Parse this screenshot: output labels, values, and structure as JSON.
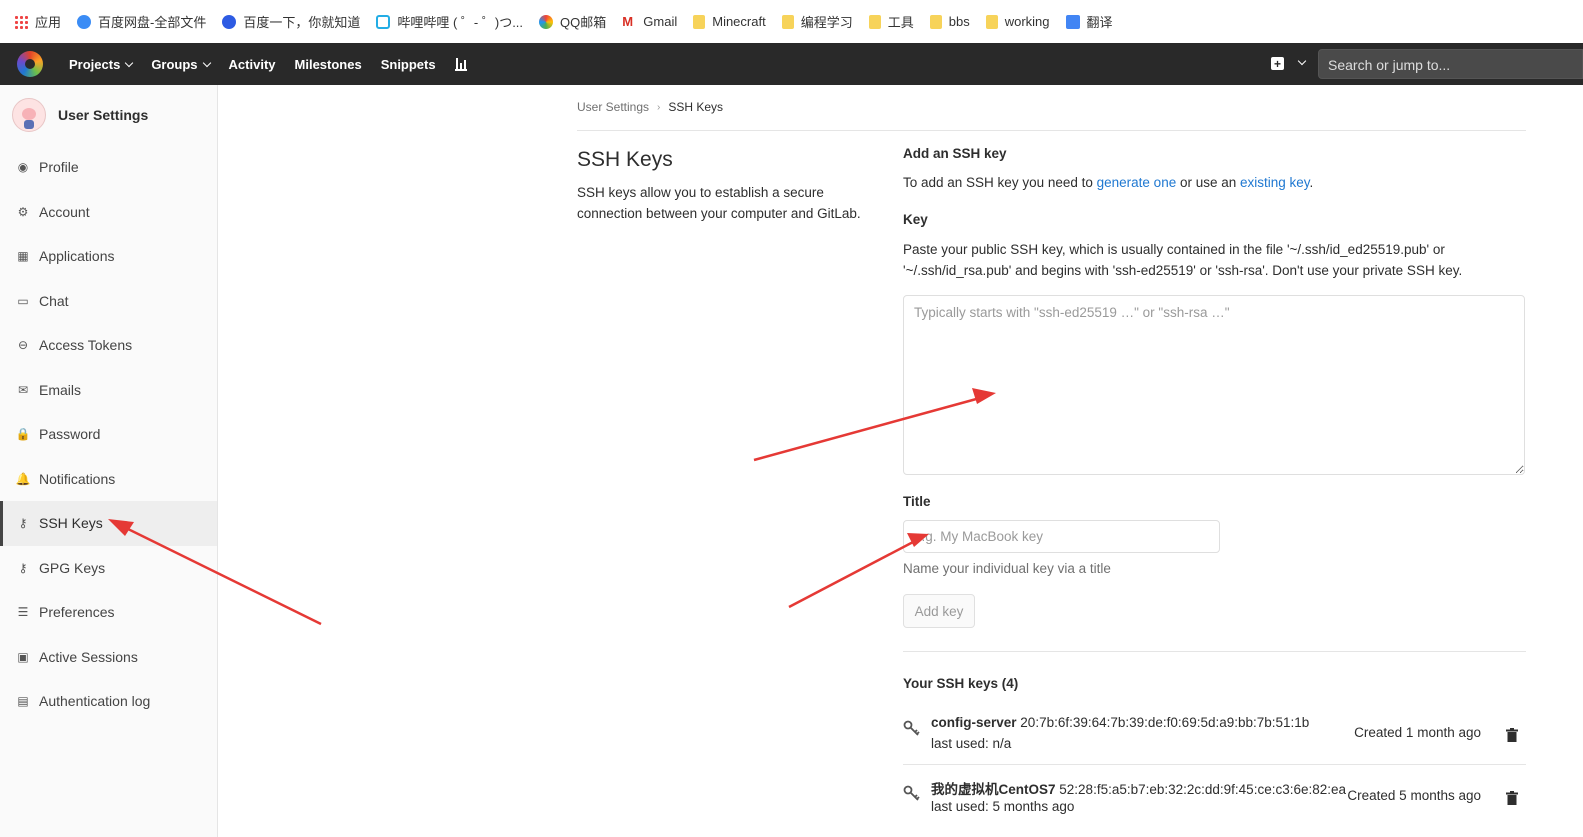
{
  "bookmarks": [
    {
      "label": "应用",
      "icon": "apps-grid-icon"
    },
    {
      "label": "百度网盘-全部文件",
      "icon": "baidu-netdisk-icon"
    },
    {
      "label": "百度一下，你就知道",
      "icon": "baidu-paw-icon"
    },
    {
      "label": "哔哩哔哩 ( ゜- ゜)つ...",
      "icon": "bilibili-tv-icon"
    },
    {
      "label": "QQ邮箱",
      "icon": "qq-mail-icon"
    },
    {
      "label": "Gmail",
      "icon": "gmail-icon"
    },
    {
      "label": "Minecraft",
      "icon": "folder-icon"
    },
    {
      "label": "编程学习",
      "icon": "folder-icon"
    },
    {
      "label": "工具",
      "icon": "folder-icon"
    },
    {
      "label": "bbs",
      "icon": "folder-icon"
    },
    {
      "label": "working",
      "icon": "folder-icon"
    },
    {
      "label": "翻译",
      "icon": "google-translate-icon"
    }
  ],
  "navbar": {
    "items": [
      {
        "label": "Projects",
        "dropdown": true
      },
      {
        "label": "Groups",
        "dropdown": true
      },
      {
        "label": "Activity",
        "dropdown": false
      },
      {
        "label": "Milestones",
        "dropdown": false
      },
      {
        "label": "Snippets",
        "dropdown": false
      }
    ],
    "plus_glyph": "+",
    "search_placeholder": "Search or jump to..."
  },
  "sidebar": {
    "title": "User Settings",
    "items": [
      {
        "label": "Profile",
        "icon": "profile-icon",
        "glyph": "◉",
        "active": false
      },
      {
        "label": "Account",
        "icon": "account-icon",
        "glyph": "⚙",
        "active": false
      },
      {
        "label": "Applications",
        "icon": "applications-icon",
        "glyph": "▦",
        "active": false
      },
      {
        "label": "Chat",
        "icon": "chat-icon",
        "glyph": "▭",
        "active": false
      },
      {
        "label": "Access Tokens",
        "icon": "access-tokens-icon",
        "glyph": "⊖",
        "active": false
      },
      {
        "label": "Emails",
        "icon": "emails-icon",
        "glyph": "✉",
        "active": false
      },
      {
        "label": "Password",
        "icon": "lock-icon",
        "glyph": "🔒",
        "active": false
      },
      {
        "label": "Notifications",
        "icon": "bell-icon",
        "glyph": "🔔",
        "active": false
      },
      {
        "label": "SSH Keys",
        "icon": "key-icon",
        "glyph": "⚷",
        "active": true
      },
      {
        "label": "GPG Keys",
        "icon": "key-icon",
        "glyph": "⚷",
        "active": false
      },
      {
        "label": "Preferences",
        "icon": "preferences-icon",
        "glyph": "☰",
        "active": false
      },
      {
        "label": "Active Sessions",
        "icon": "monitor-icon",
        "glyph": "▣",
        "active": false
      },
      {
        "label": "Authentication log",
        "icon": "log-icon",
        "glyph": "▤",
        "active": false
      }
    ]
  },
  "breadcrumb": {
    "parent": "User Settings",
    "separator": "›",
    "current": "SSH Keys"
  },
  "intro": {
    "title": "SSH Keys",
    "description": "SSH keys allow you to establish a secure connection between your computer and GitLab."
  },
  "form": {
    "heading": "Add an SSH key",
    "intro_prefix": "To add an SSH key you need to ",
    "generate_link": "generate one",
    "intro_middle": " or use an ",
    "existing_link": "existing key",
    "intro_suffix": ".",
    "key_label": "Key",
    "key_help": "Paste your public SSH key, which is usually contained in the file '~/.ssh/id_ed25519.pub' or '~/.ssh/id_rsa.pub' and begins with 'ssh-ed25519' or 'ssh-rsa'. Don't use your private SSH key.",
    "key_placeholder": "Typically starts with \"ssh-ed25519 …\" or \"ssh-rsa …\"",
    "title_label": "Title",
    "title_placeholder": "e.g. My MacBook key",
    "title_help": "Name your individual key via a title",
    "submit_label": "Add key"
  },
  "keys": {
    "heading": "Your SSH keys (4)",
    "items": [
      {
        "name": "config-server",
        "fingerprint": "20:7b:6f:39:64:7b:39:de:f0:69:5d:a9:bb:7b:51:1b",
        "last_used": "last used: n/a",
        "created": "Created 1 month ago"
      },
      {
        "name": "我的虚拟机CentOS7",
        "fingerprint": "52:28:f5:a5:b7:eb:32:2c:dd:9f:45:ce:c3:6e:82:ea",
        "last_used": "last used: 5 months ago",
        "created": "Created 5 months ago"
      }
    ]
  },
  "annotation_color": "#e53935"
}
